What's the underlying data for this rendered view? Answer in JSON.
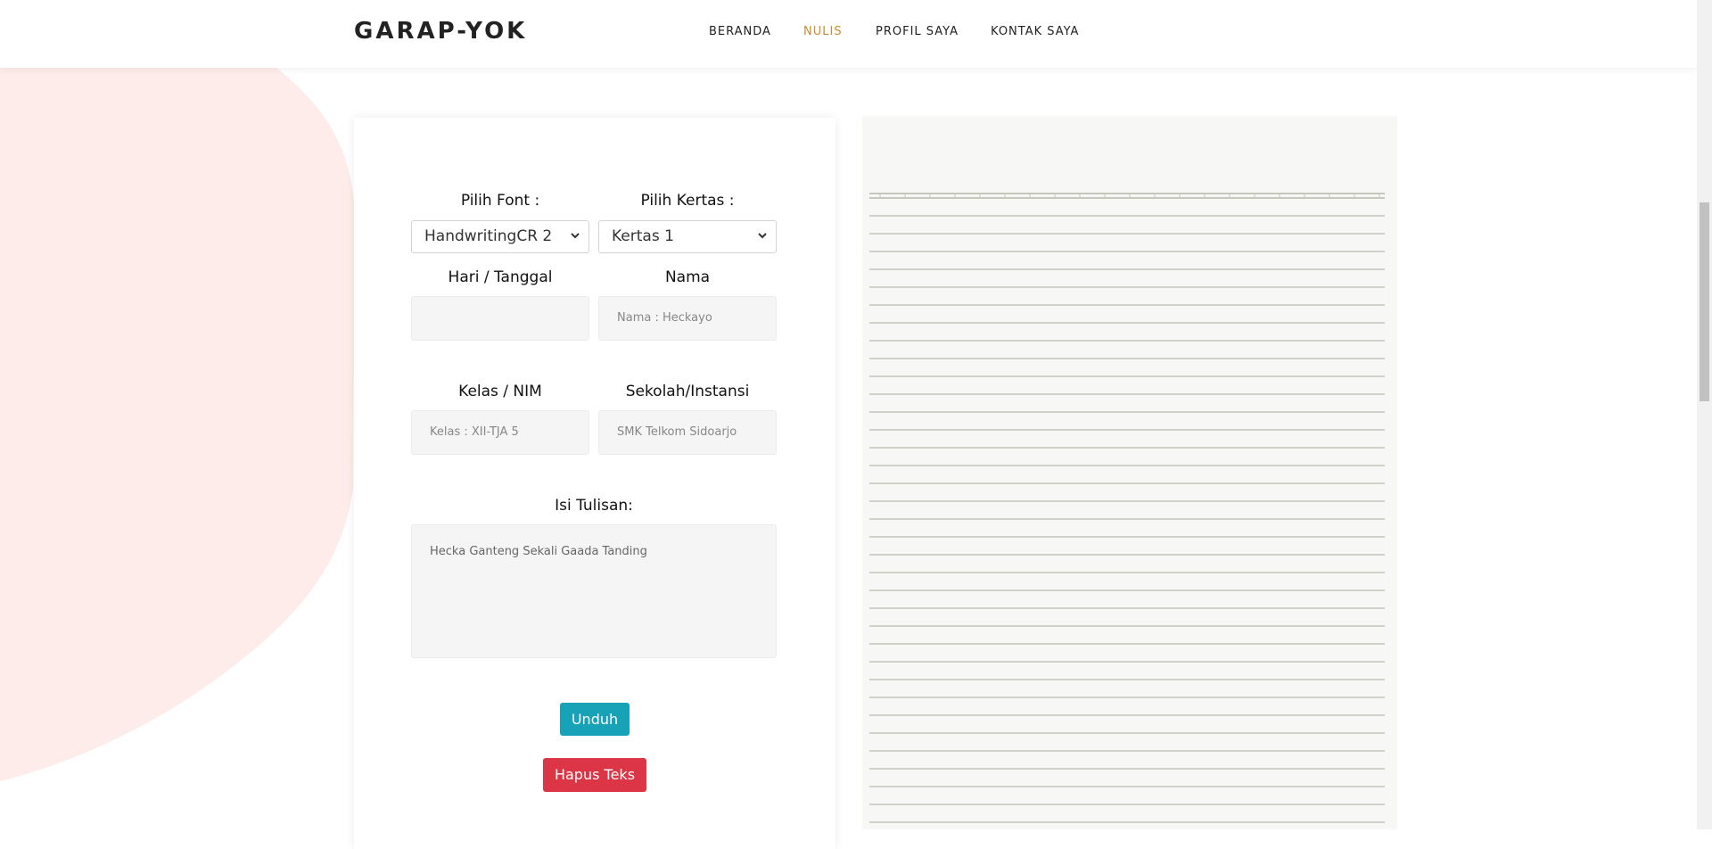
{
  "header": {
    "logo": "GARAP-YOK",
    "nav": [
      {
        "label": "BERANDA",
        "active": false
      },
      {
        "label": "NULIS",
        "active": true
      },
      {
        "label": "PROFIL SAYA",
        "active": false
      },
      {
        "label": "KONTAK SAYA",
        "active": false
      }
    ]
  },
  "form": {
    "font_label": "Pilih Font :",
    "font_value": "HandwritingCR 2",
    "paper_label": "Pilih Kertas :",
    "paper_value": "Kertas 1",
    "date_label": "Hari / Tanggal",
    "date_value": "",
    "name_label": "Nama",
    "name_placeholder": "Nama : Heckayo",
    "class_label": "Kelas / NIM",
    "class_placeholder": "Kelas : XII-TJA 5",
    "school_label": "Sekolah/Instansi",
    "school_placeholder": "SMK Telkom Sidoarjo",
    "content_label": "Isi Tulisan:",
    "content_value": "Hecka Ganteng Sekali Gaada Tanding",
    "download_button": "Unduh",
    "clear_button": "Hapus Teks"
  },
  "colors": {
    "accent_nav": "#c98c2e",
    "download": "#17a2b8",
    "clear": "#dc3545",
    "blob": "#fdecea"
  }
}
